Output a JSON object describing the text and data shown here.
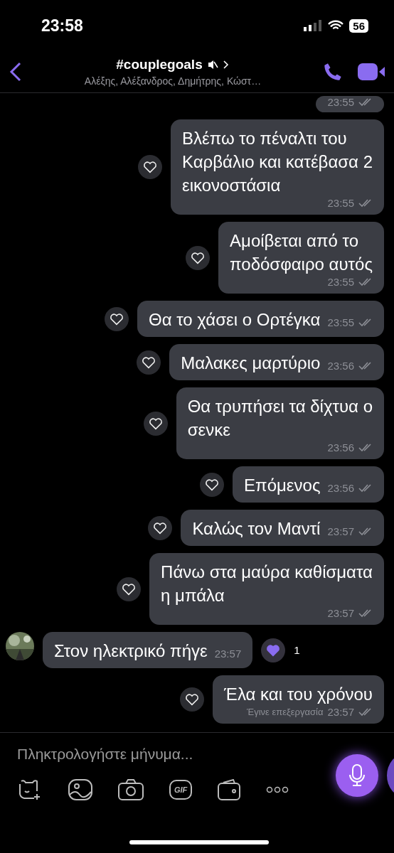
{
  "status_bar": {
    "time": "23:58",
    "battery": "56"
  },
  "header": {
    "title": "#couplegoals",
    "muted": true,
    "members": "Αλέξης, Αλέξανδρος, Δημήτρης, Κώστ…"
  },
  "messages": [
    {
      "kind": "outgoing",
      "time": "23:55"
    },
    {
      "kind": "outgoing",
      "text": "Βλέπω το πέναλτι του\nΚαρβάλιο και κατέβασα 2\nεικονοστάσια",
      "time": "23:55",
      "liked": false
    },
    {
      "kind": "outgoing",
      "text": "Αμοίβεται από το\nποδόσφαιρο αυτός",
      "time": "23:55",
      "liked": false
    },
    {
      "kind": "outgoing",
      "text": "Θα το χάσει ο Ορτέγκα",
      "time": "23:55",
      "liked": false
    },
    {
      "kind": "outgoing",
      "text": "Μαλακες μαρτύριο",
      "time": "23:56",
      "liked": false
    },
    {
      "kind": "outgoing",
      "text": "Θα τρυπήσει τα δίχτυα ο\nσενκε",
      "time": "23:56",
      "liked": false
    },
    {
      "kind": "outgoing",
      "text": "Επόμενος",
      "time": "23:56",
      "liked": false
    },
    {
      "kind": "outgoing",
      "text": "Καλώς τον Μαντί",
      "time": "23:57",
      "liked": false
    },
    {
      "kind": "outgoing",
      "text": "Πάνω στα μαύρα καθίσματα\nη μπάλα",
      "time": "23:57",
      "liked": false
    },
    {
      "kind": "incoming",
      "text": "Στον ηλεκτρικό πήγε",
      "time": "23:57",
      "liked": true,
      "like_count": "1"
    },
    {
      "kind": "outgoing",
      "text": "Έλα και του χρόνου",
      "time": "23:57",
      "edited_label": "Έγινε επεξεργασία",
      "liked": false
    }
  ],
  "composer": {
    "placeholder": "Πληκτρολογήστε μήνυμα...",
    "gif_label": "GIF"
  }
}
